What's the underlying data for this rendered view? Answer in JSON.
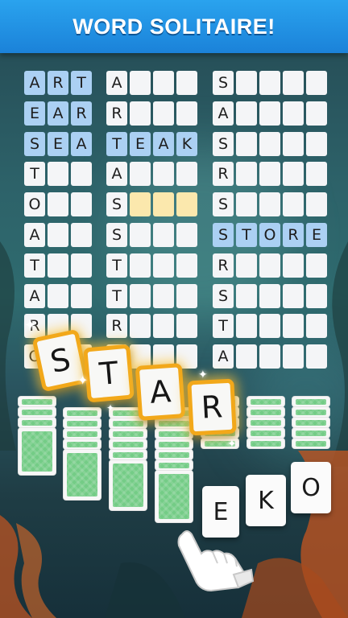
{
  "banner": {
    "title": "WORD SOLITAIRE!"
  },
  "board": {
    "columns": [
      {
        "rows": [
          {
            "cells": [
              "A",
              "R",
              "T"
            ],
            "style": "blue"
          },
          {
            "cells": [
              "E",
              "A",
              "R"
            ],
            "style": "blue"
          },
          {
            "cells": [
              "S",
              "E",
              "A"
            ],
            "style": "blue"
          },
          {
            "cells": [
              "T",
              "",
              ""
            ],
            "style": "plain"
          },
          {
            "cells": [
              "O",
              "",
              ""
            ],
            "style": "plain"
          },
          {
            "cells": [
              "A",
              "",
              ""
            ],
            "style": "plain"
          },
          {
            "cells": [
              "T",
              "",
              ""
            ],
            "style": "plain"
          },
          {
            "cells": [
              "A",
              "",
              ""
            ],
            "style": "plain"
          },
          {
            "cells": [
              "R",
              "",
              ""
            ],
            "style": "plain"
          },
          {
            "cells": [
              "O",
              "",
              ""
            ],
            "style": "plain"
          }
        ]
      },
      {
        "rows": [
          {
            "cells": [
              "A",
              "",
              "",
              ""
            ],
            "style": "first"
          },
          {
            "cells": [
              "R",
              "",
              "",
              ""
            ],
            "style": "plain"
          },
          {
            "cells": [
              "T",
              "E",
              "A",
              "K"
            ],
            "style": "blue"
          },
          {
            "cells": [
              "A",
              "",
              "",
              ""
            ],
            "style": "plain"
          },
          {
            "cells": [
              "S",
              "",
              "",
              ""
            ],
            "style": "yellow"
          },
          {
            "cells": [
              "S",
              "",
              "",
              ""
            ],
            "style": "plain"
          },
          {
            "cells": [
              "T",
              "",
              "",
              ""
            ],
            "style": "plain"
          },
          {
            "cells": [
              "T",
              "",
              "",
              ""
            ],
            "style": "plain"
          },
          {
            "cells": [
              "R",
              "",
              "",
              ""
            ],
            "style": "plain"
          },
          {
            "cells": [
              "A",
              "",
              "",
              ""
            ],
            "style": "plain"
          }
        ]
      },
      {
        "rows": [
          {
            "cells": [
              "S",
              "",
              "",
              "",
              ""
            ],
            "style": "plain"
          },
          {
            "cells": [
              "A",
              "",
              "",
              "",
              ""
            ],
            "style": "plain"
          },
          {
            "cells": [
              "S",
              "",
              "",
              "",
              ""
            ],
            "style": "plain"
          },
          {
            "cells": [
              "R",
              "",
              "",
              "",
              ""
            ],
            "style": "plain"
          },
          {
            "cells": [
              "S",
              "",
              "",
              "",
              ""
            ],
            "style": "plain"
          },
          {
            "cells": [
              "S",
              "T",
              "O",
              "R",
              "E"
            ],
            "style": "blue"
          },
          {
            "cells": [
              "R",
              "",
              "",
              "",
              ""
            ],
            "style": "plain"
          },
          {
            "cells": [
              "S",
              "",
              "",
              "",
              ""
            ],
            "style": "plain"
          },
          {
            "cells": [
              "T",
              "",
              "",
              "",
              ""
            ],
            "style": "plain"
          },
          {
            "cells": [
              "A",
              "",
              "",
              "",
              ""
            ],
            "style": "plain"
          }
        ]
      }
    ]
  },
  "hand_tiles": {
    "t1": "S",
    "t2": "T",
    "t3": "A",
    "t4": "R"
  },
  "face_up_cards": {
    "e": "E",
    "k": "K",
    "o": "O"
  },
  "colors": {
    "banner": "#1f8fe3",
    "blue_cell": "#abd0f3",
    "yellow_cell": "#fbe8ad",
    "card_back": "#74cc86",
    "tile_border": "#f2a81a"
  },
  "icons": {
    "hand": "pointing-hand-icon",
    "sparkle": "sparkle-icon"
  }
}
